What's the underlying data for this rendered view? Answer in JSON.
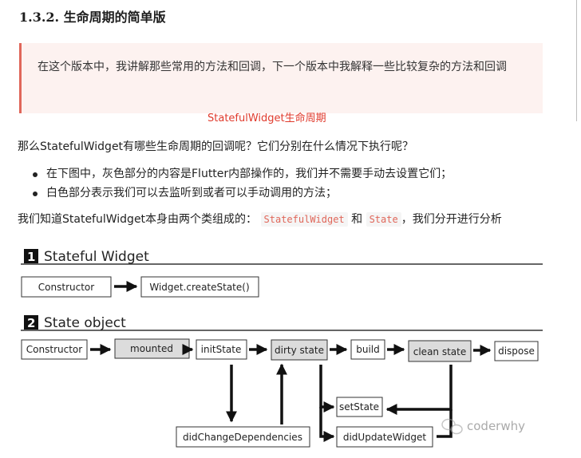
{
  "section": {
    "heading": "1.3.2. 生命周期的简单版"
  },
  "callout": {
    "text": "在这个版本中，我讲解那些常用的方法和回调，下一个版本中我解释一些比较复杂的方法和回调"
  },
  "figure_caption": "StatefulWidget生命周期",
  "paragraph1": "那么StatefulWidget有哪些生命周期的回调呢？它们分别在什么情况下执行呢？",
  "bullets": [
    "在下图中，灰色部分的内容是Flutter内部操作的，我们并不需要手动去设置它们；",
    "白色部分表示我们可以去监听到或者可以手动调用的方法；"
  ],
  "paragraph2": {
    "prefix": "我们知道StatefulWidget本身由两个类组成的：",
    "code1": "StatefulWidget",
    "middle": "和",
    "code2": "State",
    "suffix": "，我们分开进行分析"
  },
  "diagram": {
    "part1": {
      "number": "1",
      "title": "Stateful Widget",
      "boxes": [
        "Constructor",
        "Widget.createState()"
      ]
    },
    "part2": {
      "number": "2",
      "title": "State object",
      "boxes": [
        "Constructor",
        "mounted",
        "initState",
        "dirty state",
        "build",
        "clean state",
        "dispose"
      ],
      "side_boxes": [
        "setState",
        "didChangeDependencies",
        "didUpdateWidget"
      ]
    },
    "watermark": "coderwhy"
  }
}
